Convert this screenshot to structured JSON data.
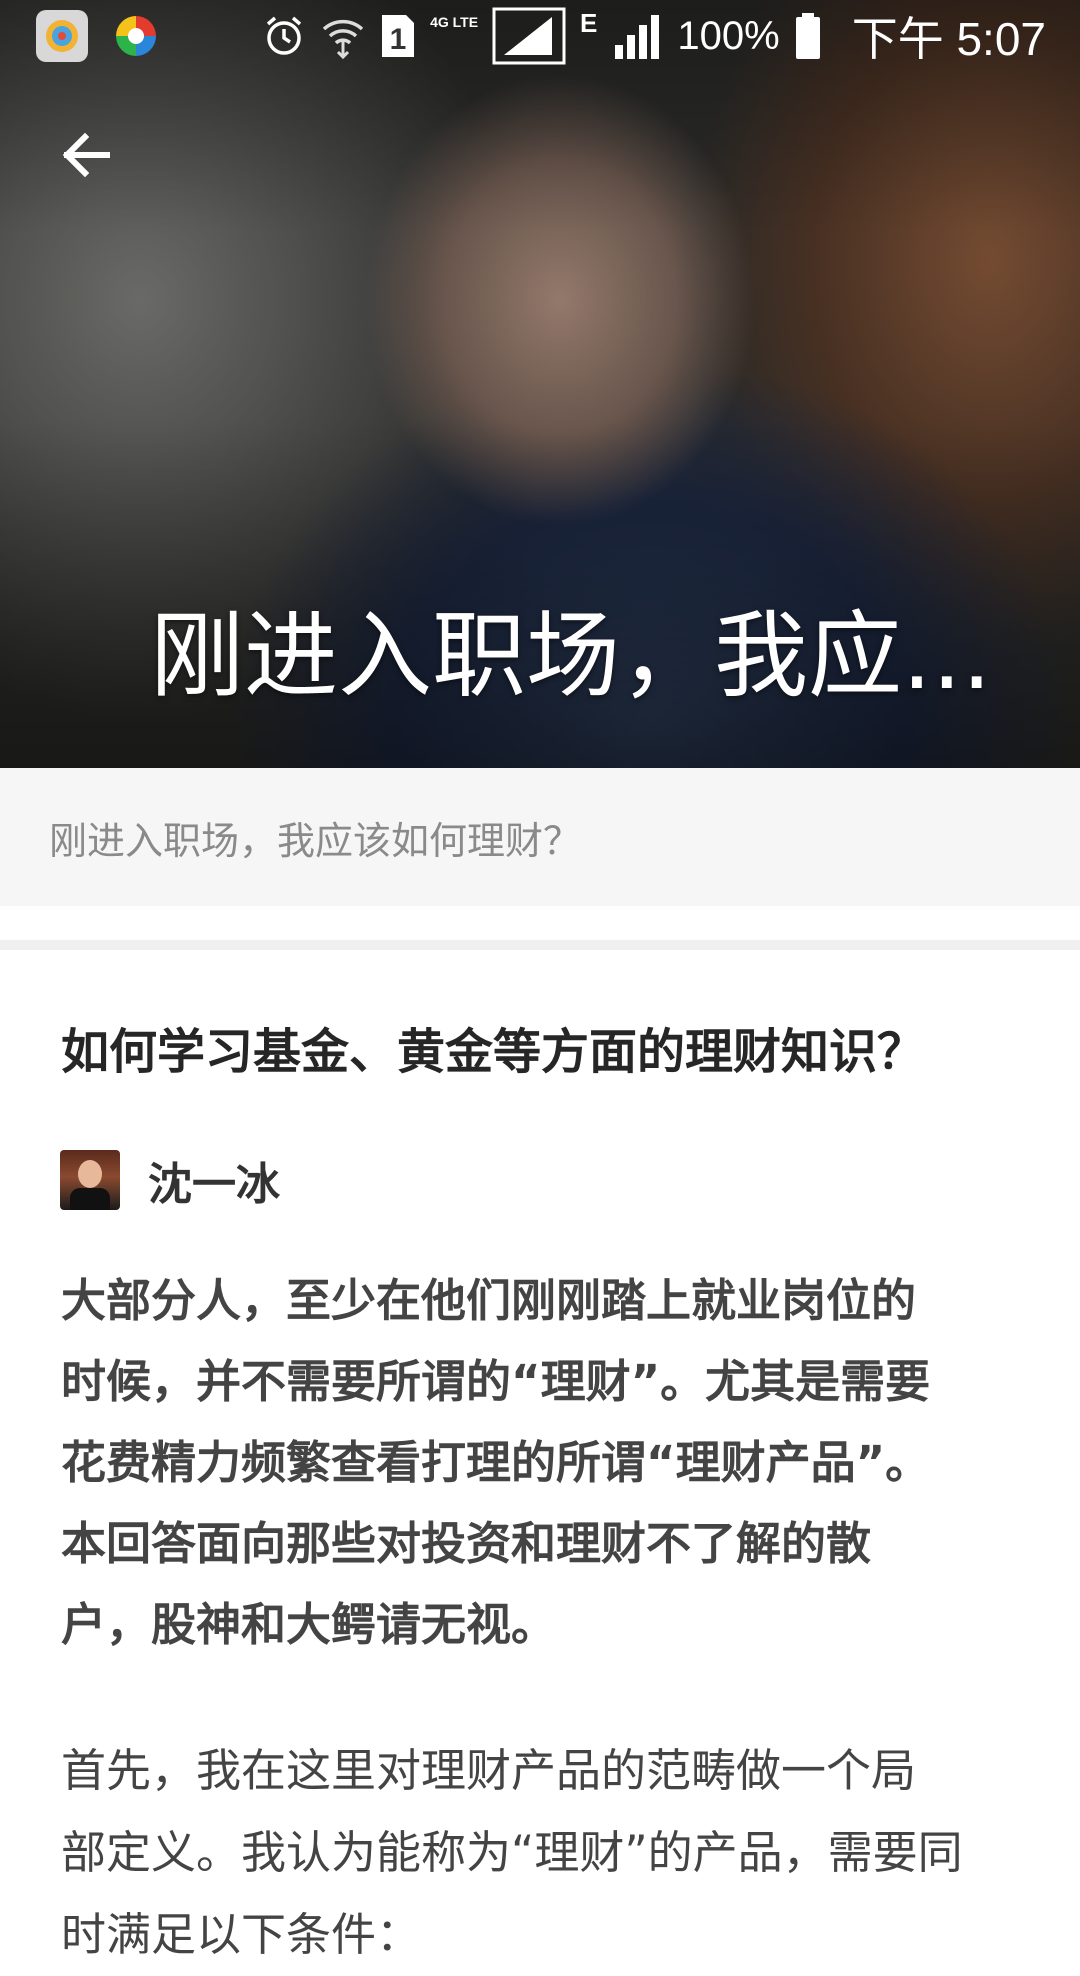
{
  "status_bar": {
    "network_small": "4G LTE",
    "sim_label": "1",
    "e_label": "E",
    "battery": "100%",
    "time": "下午 5:07"
  },
  "icons": {
    "back": "arrow-left-icon",
    "alarm": "alarm-clock-icon",
    "wifi": "wifi-icon"
  },
  "hero": {
    "title": "刚进入职场，我应..."
  },
  "topic": {
    "label": "刚进入职场，我应该如何理财？"
  },
  "question": {
    "title": "如何学习基金、黄金等方面的理财知识？"
  },
  "author": {
    "name": "沈一冰"
  },
  "answer": {
    "bold_lines": [
      "大部分人，至少在他们刚刚踏上就业岗位的",
      "时候，并不需要所谓的“理财”。尤其是需要",
      "花费精力频繁查看打理的所谓“理财产品”。",
      "本回答面向那些对投资和理财不了解的散",
      "户，股神和大鳄请无视。"
    ],
    "normal_lines": [
      "首先，我在这里对理财产品的范畴做一个局",
      "部定义。我认为能称为“理财”的产品，需要同",
      "时满足以下条件："
    ]
  }
}
